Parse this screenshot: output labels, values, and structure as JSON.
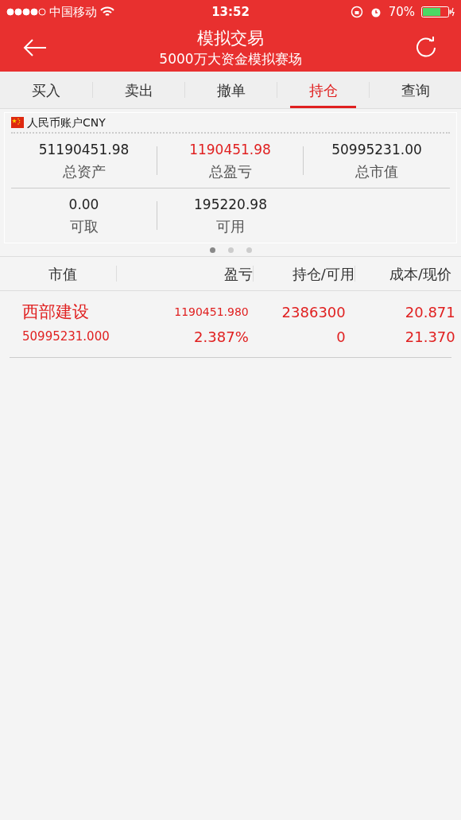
{
  "status_bar": {
    "carrier": "中国移动",
    "time": "13:52",
    "battery": "70%"
  },
  "nav": {
    "title": "模拟交易",
    "subtitle": "5000万大资金模拟赛场"
  },
  "tabs": [
    {
      "label": "买入",
      "selected": false
    },
    {
      "label": "卖出",
      "selected": false
    },
    {
      "label": "撤单",
      "selected": false
    },
    {
      "label": "持仓",
      "selected": true
    },
    {
      "label": "查询",
      "selected": false
    }
  ],
  "account": {
    "name": "人民币账户CNY",
    "stats": [
      [
        {
          "value": "51190451.98",
          "label": "总资产",
          "color": "#222222"
        },
        {
          "value": "1190451.98",
          "label": "总盈亏",
          "color": "#e02020"
        },
        {
          "value": "50995231.00",
          "label": "总市值",
          "color": "#222222"
        }
      ],
      [
        {
          "value": "0.00",
          "label": "可取",
          "color": "#222222"
        },
        {
          "value": "195220.98",
          "label": "可用",
          "color": "#222222"
        }
      ]
    ]
  },
  "pages": [
    {
      "selected": true
    },
    {
      "selected": false
    },
    {
      "selected": false
    }
  ],
  "table": {
    "columns": [
      "市值",
      "盈亏",
      "持仓/可用",
      "成本/现价"
    ],
    "rows": [
      {
        "name": "西部建设",
        "market_value": "50995231.000",
        "profit": "1190451.980",
        "profit_pct": "2.387%",
        "holding": "2386300",
        "available": "0",
        "cost": "20.871",
        "price": "21.370"
      }
    ]
  }
}
